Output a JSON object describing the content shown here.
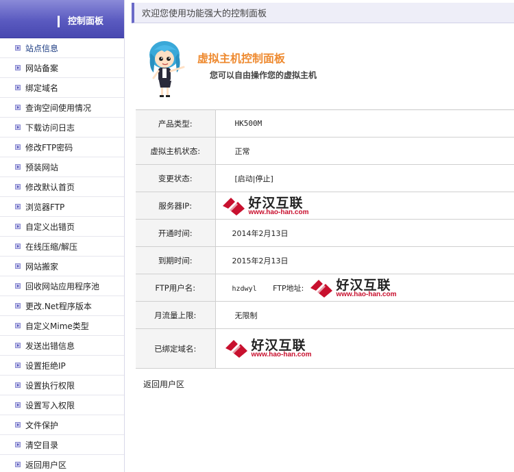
{
  "sidebar": {
    "title": "控制面板",
    "items": [
      {
        "label": "站点信息"
      },
      {
        "label": "网站备案"
      },
      {
        "label": "绑定域名"
      },
      {
        "label": "查询空间使用情况"
      },
      {
        "label": "下载访问日志"
      },
      {
        "label": "修改FTP密码"
      },
      {
        "label": "预装网站"
      },
      {
        "label": "修改默认首页"
      },
      {
        "label": "浏览器FTP"
      },
      {
        "label": "自定义出错页"
      },
      {
        "label": "在线压缩/解压"
      },
      {
        "label": "网站搬家"
      },
      {
        "label": "回收网站应用程序池"
      },
      {
        "label": "更改.Net程序版本"
      },
      {
        "label": "自定义Mime类型"
      },
      {
        "label": "发送出错信息"
      },
      {
        "label": "设置拒绝IP"
      },
      {
        "label": "设置执行权限"
      },
      {
        "label": "设置写入权限"
      },
      {
        "label": "文件保护"
      },
      {
        "label": "清空目录"
      },
      {
        "label": "返回用户区"
      }
    ]
  },
  "header": {
    "welcome": "欢迎您使用功能强大的控制面板"
  },
  "banner": {
    "title": "虚拟主机控制面板",
    "subtitle": "您可以自由操作您的虚拟主机"
  },
  "info": {
    "product_type": {
      "label": "产品类型:",
      "value": "HK500M"
    },
    "host_status": {
      "label": "虚拟主机状态:",
      "value": "正常"
    },
    "change_status": {
      "label": "变更状态:",
      "value": "[启动|停止]"
    },
    "server_ip": {
      "label": "服务器IP:",
      "value": ""
    },
    "open_time": {
      "label": "开通时间:",
      "value": "2014年2月13日"
    },
    "expire_time": {
      "label": "到期时间:",
      "value": "2015年2月13日"
    },
    "ftp_user": {
      "label": "FTP用户名:",
      "value": "hzdwyl",
      "ftp_addr_label": "FTP地址:"
    },
    "traffic_limit": {
      "label": "月流量上限:",
      "value": "无限制"
    },
    "bound_domains": {
      "label": "已绑定域名:"
    }
  },
  "watermark": {
    "brand": "好汉互联",
    "url": "www.hao-han.com"
  },
  "footer": {
    "back_label": "返回用户区"
  },
  "colors": {
    "sidebar_header": "#5a5ac0",
    "banner_title": "#ee8a30",
    "watermark_red": "#c8102e"
  }
}
